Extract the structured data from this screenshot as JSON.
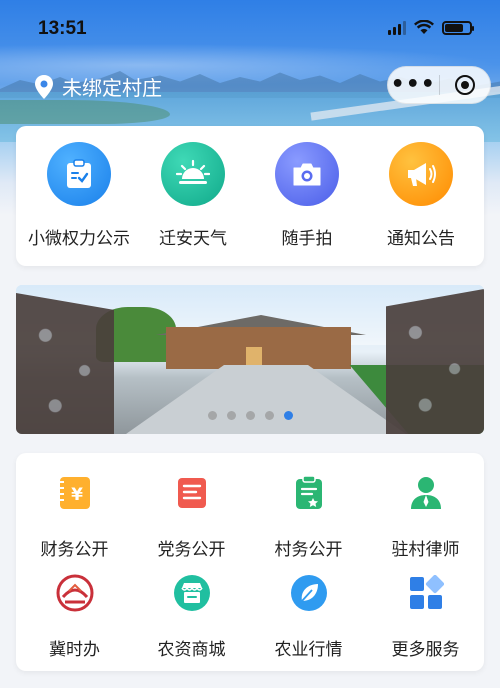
{
  "status_bar": {
    "time": "13:51"
  },
  "location": {
    "label": "未绑定村庄",
    "icon": "location-pin-icon"
  },
  "capsule": {
    "more_label": "•••",
    "more_icon": "more-dots-icon",
    "close_icon": "target-close-icon"
  },
  "quick_entries": [
    {
      "label": "小微权力公示",
      "icon": "clipboard-check-icon",
      "color": "#2c8ef0"
    },
    {
      "label": "迁安天气",
      "icon": "sun-weather-icon",
      "color": "#16b99a"
    },
    {
      "label": "随手拍",
      "icon": "camera-icon",
      "color": "#5a6cf0"
    },
    {
      "label": "通知公告",
      "icon": "megaphone-icon",
      "color": "#ff9a10"
    }
  ],
  "banner": {
    "image": "village-courtyard-photo",
    "slide_count": 5,
    "active_slide": 5
  },
  "services": [
    {
      "label": "财务公开",
      "icon": "finance-yuan-icon",
      "color": "#ffa726"
    },
    {
      "label": "党务公开",
      "icon": "party-document-icon",
      "color": "#f05a4f"
    },
    {
      "label": "村务公开",
      "icon": "village-document-icon",
      "color": "#2bb673"
    },
    {
      "label": "驻村律师",
      "icon": "lawyer-person-icon",
      "color": "#2bb673"
    },
    {
      "label": "冀时办",
      "icon": "jishiban-logo-icon",
      "color": "#c9303a"
    },
    {
      "label": "农资商城",
      "icon": "store-icon",
      "color": "#20bfa0"
    },
    {
      "label": "农业行情",
      "icon": "leaf-market-icon",
      "color": "#2f9bf0"
    },
    {
      "label": "更多服务",
      "icon": "grid-more-icon",
      "color": "#2f7fe6"
    }
  ]
}
